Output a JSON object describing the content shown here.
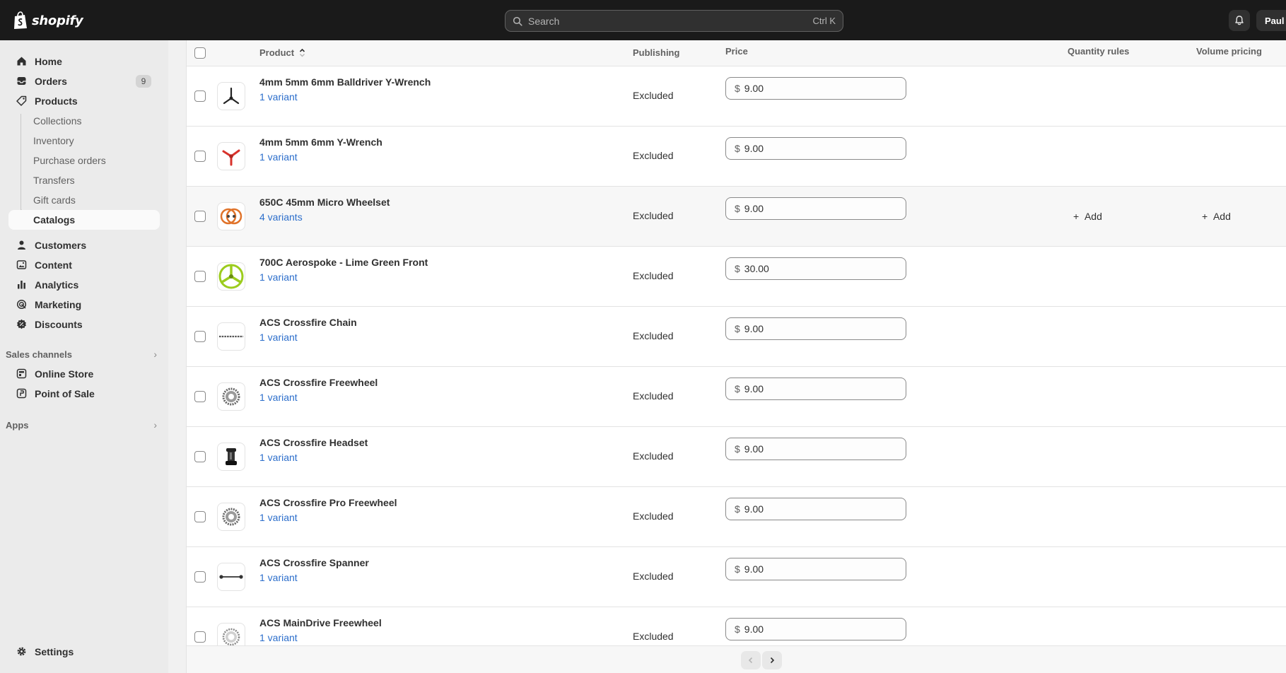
{
  "brand": {
    "name": "shopify"
  },
  "search": {
    "placeholder": "Search",
    "shortcut": "Ctrl K"
  },
  "user": {
    "name": "Paul R"
  },
  "sidebar": {
    "main": [
      {
        "label": "Home",
        "icon": "home-icon"
      },
      {
        "label": "Orders",
        "icon": "inbox-icon",
        "badge": "9"
      },
      {
        "label": "Products",
        "icon": "tag-icon"
      }
    ],
    "products_sub": [
      "Collections",
      "Inventory",
      "Purchase orders",
      "Transfers",
      "Gift cards",
      "Catalogs"
    ],
    "more": [
      {
        "label": "Customers",
        "icon": "person-icon"
      },
      {
        "label": "Content",
        "icon": "content-icon"
      },
      {
        "label": "Analytics",
        "icon": "bar-chart-icon"
      },
      {
        "label": "Marketing",
        "icon": "target-icon"
      },
      {
        "label": "Discounts",
        "icon": "discount-icon"
      }
    ],
    "sales_channels_label": "Sales channels",
    "channels": [
      {
        "label": "Online Store",
        "icon": "store-icon"
      },
      {
        "label": "Point of Sale",
        "icon": "pos-icon"
      }
    ],
    "apps_label": "Apps",
    "settings_label": "Settings"
  },
  "table": {
    "headers": {
      "product": "Product",
      "publishing": "Publishing",
      "price": "Price",
      "quantity_rules": "Quantity rules",
      "volume_pricing": "Volume pricing"
    },
    "add_label": "Add",
    "rows": [
      {
        "name": "4mm 5mm 6mm Balldriver Y-Wrench",
        "variants": "1 variant",
        "publishing": "Excluded",
        "currency": "$",
        "price": "9.00",
        "thumb": "ywrench-black"
      },
      {
        "name": "4mm 5mm 6mm Y-Wrench",
        "variants": "1 variant",
        "publishing": "Excluded",
        "currency": "$",
        "price": "9.00",
        "thumb": "ywrench-red"
      },
      {
        "name": "650C 45mm Micro Wheelset",
        "variants": "4 variants",
        "publishing": "Excluded",
        "currency": "$",
        "price": "9.00",
        "thumb": "wheelset"
      },
      {
        "name": "700C Aerospoke - Lime Green Front",
        "variants": "1 variant",
        "publishing": "Excluded",
        "currency": "$",
        "price": "30.00",
        "thumb": "aerospoke"
      },
      {
        "name": "ACS Crossfire Chain",
        "variants": "1 variant",
        "publishing": "Excluded",
        "currency": "$",
        "price": "9.00",
        "thumb": "chain"
      },
      {
        "name": "ACS Crossfire Freewheel",
        "variants": "1 variant",
        "publishing": "Excluded",
        "currency": "$",
        "price": "9.00",
        "thumb": "freewheel"
      },
      {
        "name": "ACS Crossfire Headset",
        "variants": "1 variant",
        "publishing": "Excluded",
        "currency": "$",
        "price": "9.00",
        "thumb": "headset"
      },
      {
        "name": "ACS Crossfire Pro Freewheel",
        "variants": "1 variant",
        "publishing": "Excluded",
        "currency": "$",
        "price": "9.00",
        "thumb": "freewheel"
      },
      {
        "name": "ACS Crossfire Spanner",
        "variants": "1 variant",
        "publishing": "Excluded",
        "currency": "$",
        "price": "9.00",
        "thumb": "spanner"
      },
      {
        "name": "ACS MainDrive Freewheel",
        "variants": "1 variant",
        "publishing": "Excluded",
        "currency": "$",
        "price": "9.00",
        "thumb": "freewheel-light"
      }
    ]
  },
  "colors": {
    "topbar": "#1a1a1a",
    "sidebar": "#ebebeb",
    "link": "#2c6ecb",
    "lime": "#9ccc1e",
    "red": "#d8322b"
  }
}
